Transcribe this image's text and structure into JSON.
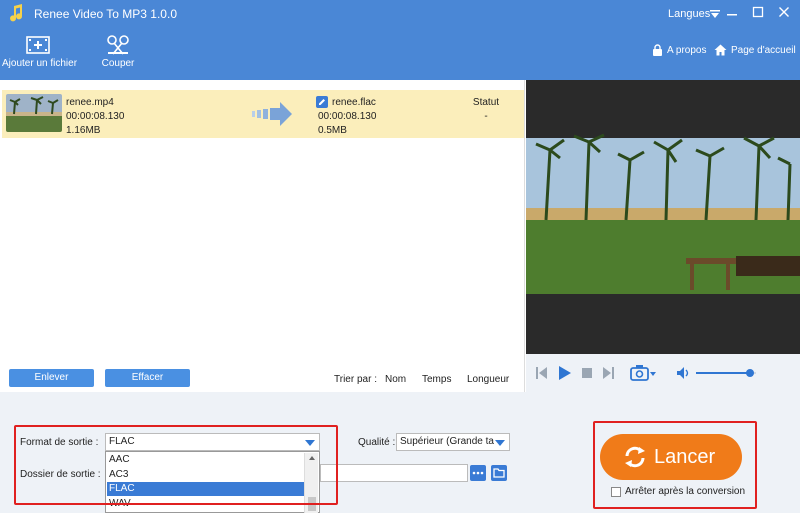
{
  "window": {
    "title": "Renee Video To MP3 1.0.0",
    "language_label": "Langues",
    "controls": [
      "minimize",
      "maximize",
      "close"
    ]
  },
  "toolbar": {
    "add_file_label": "Ajouter un fichier",
    "cut_label": "Couper",
    "about_label": "A propos",
    "home_label": "Page d'accueil"
  },
  "file_row": {
    "source": {
      "name": "renee.mp4",
      "duration": "00:00:08.130",
      "size": "1.16MB"
    },
    "output": {
      "name": "renee.flac",
      "duration": "00:00:08.130",
      "size": "0.5MB"
    },
    "status_header": "Statut",
    "status_value": "-"
  },
  "list_actions": {
    "remove_label": "Enlever",
    "clear_label": "Effacer",
    "sort_label": "Trier par :",
    "sort_name": "Nom",
    "sort_time": "Temps",
    "sort_length": "Longueur"
  },
  "player": {
    "volume_fraction": 0.9
  },
  "settings": {
    "format_label": "Format de sortie :",
    "format_value": "FLAC",
    "format_options": [
      "AAC",
      "AC3",
      "FLAC",
      "WAV"
    ],
    "format_selected_index": 2,
    "quality_label": "Qualité :",
    "quality_value": "Supérieur (Grande ta",
    "folder_label": "Dossier de sortie :",
    "folder_value": ""
  },
  "launch": {
    "label": "Lancer",
    "stop_after_label": "Arrêter après la conversion",
    "stop_after_checked": false
  },
  "colors": {
    "header_blue": "#4a87d6",
    "row_highlight": "#fbeebb",
    "launch_orange": "#f07b19",
    "selected_option": "#3a7bd5",
    "annotation_red": "#e02020"
  }
}
